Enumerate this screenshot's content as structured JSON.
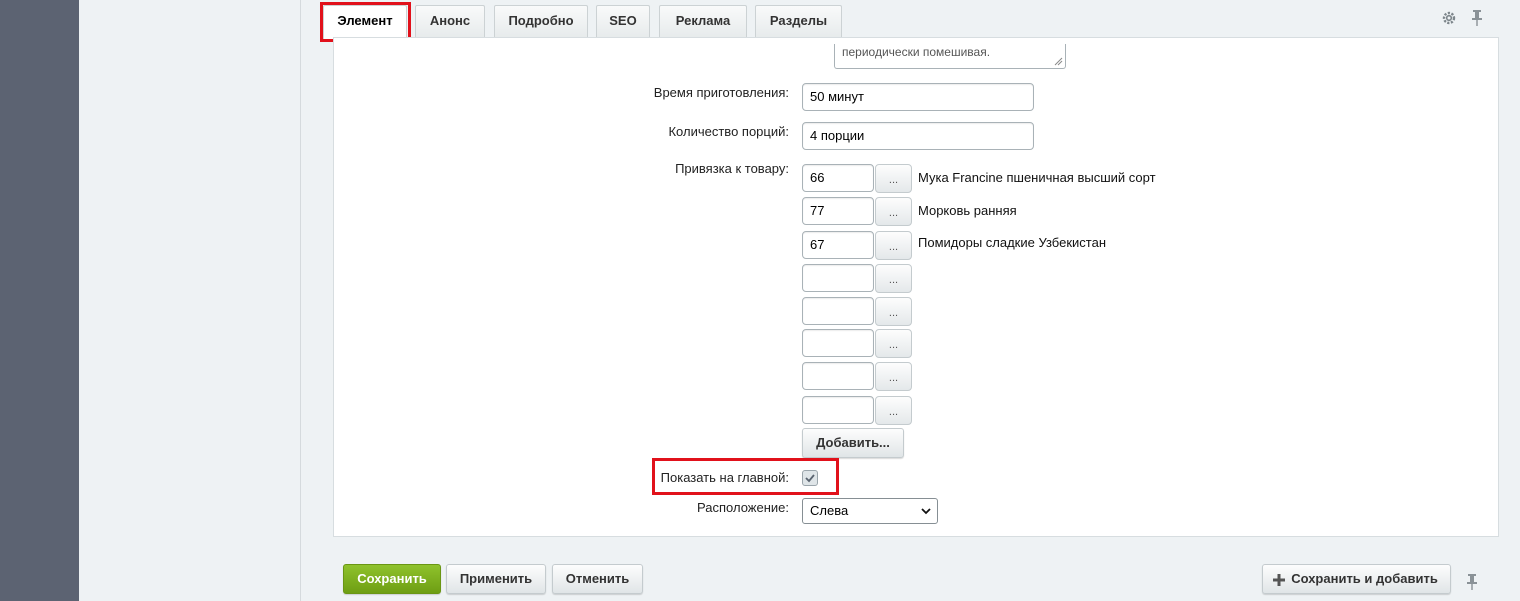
{
  "tabs": [
    {
      "label": "Элемент"
    },
    {
      "label": "Анонс"
    },
    {
      "label": "Подробно"
    },
    {
      "label": "SEO"
    },
    {
      "label": "Реклама"
    },
    {
      "label": "Разделы"
    }
  ],
  "form": {
    "textarea_tail": "периодически помешивая.",
    "cooking_time": {
      "label": "Время приготовления:",
      "value": "50 минут"
    },
    "portions": {
      "label": "Количество порций:",
      "value": "4 порции"
    },
    "product_link": {
      "label": "Привязка к товару:",
      "rows": [
        {
          "id": "66",
          "name": "Мука Francine пшеничная высший сорт"
        },
        {
          "id": "77",
          "name": "Морковь ранняя"
        },
        {
          "id": "67",
          "name": "Помидоры сладкие Узбекистан"
        },
        {
          "id": "",
          "name": ""
        },
        {
          "id": "",
          "name": ""
        },
        {
          "id": "",
          "name": ""
        },
        {
          "id": "",
          "name": ""
        },
        {
          "id": "",
          "name": ""
        }
      ],
      "browse_label": "...",
      "add_label": "Добавить..."
    },
    "show_on_main": {
      "label": "Показать на главной:",
      "checked": true
    },
    "position": {
      "label": "Расположение:",
      "selected": "Слева"
    }
  },
  "footer": {
    "save": "Сохранить",
    "apply": "Применить",
    "cancel": "Отменить",
    "save_and_add": "Сохранить и добавить"
  },
  "colors": {
    "accent_green": "#7bad1d",
    "highlight_red": "#e1111b",
    "left_strip": "#5c6372"
  }
}
